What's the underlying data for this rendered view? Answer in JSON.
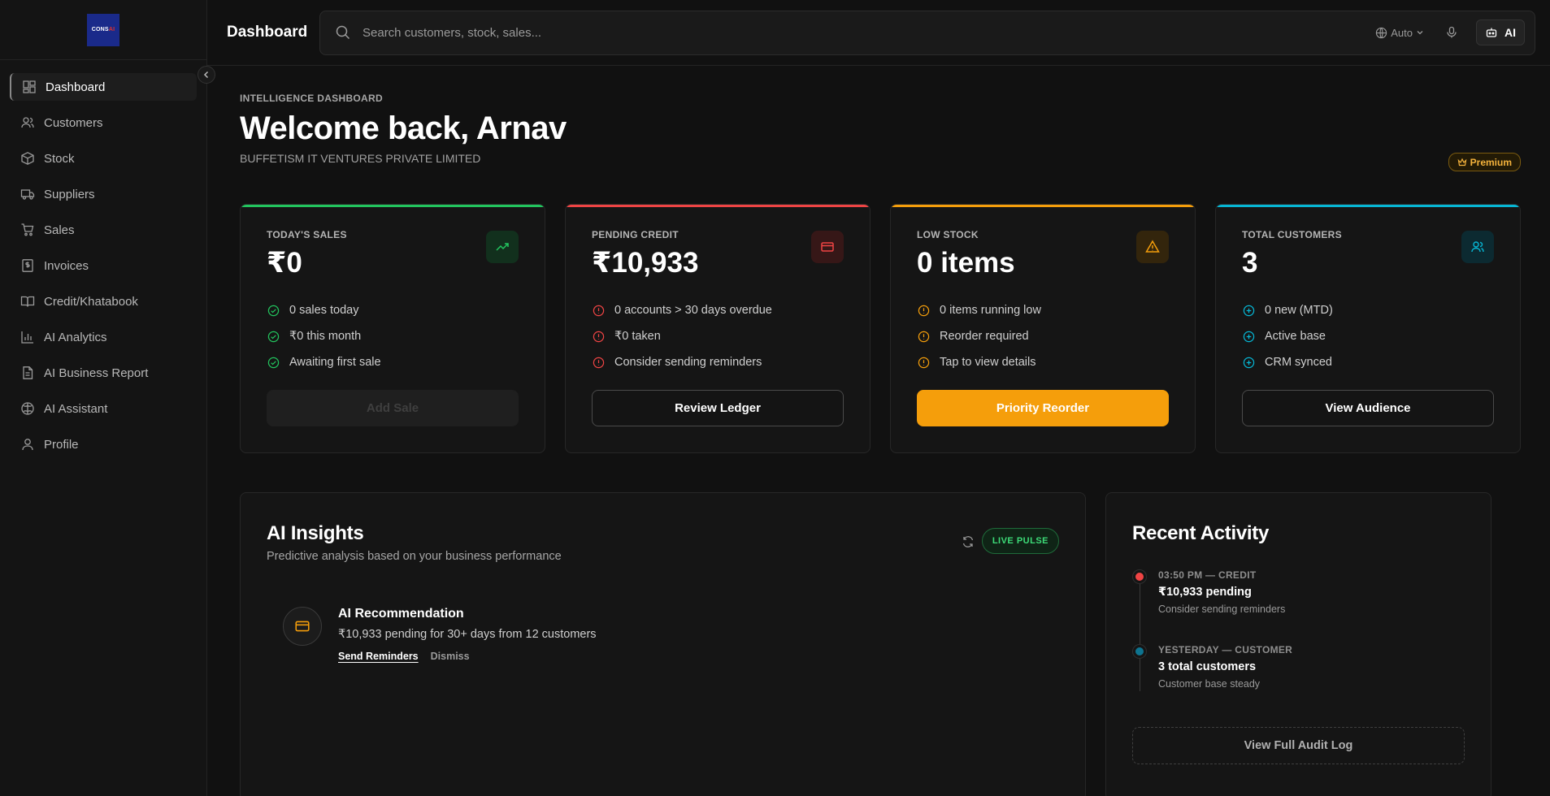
{
  "app": {
    "logo_text": "CONSAI",
    "logo_parts": [
      "CONS",
      "AI"
    ]
  },
  "sidebar": {
    "items": [
      {
        "label": "Dashboard",
        "icon": "dashboard-icon",
        "active": true
      },
      {
        "label": "Customers",
        "icon": "users-icon"
      },
      {
        "label": "Stock",
        "icon": "box-icon"
      },
      {
        "label": "Suppliers",
        "icon": "truck-icon"
      },
      {
        "label": "Sales",
        "icon": "cart-icon"
      },
      {
        "label": "Invoices",
        "icon": "invoice-icon"
      },
      {
        "label": "Credit/Khatabook",
        "icon": "book-icon"
      },
      {
        "label": "AI Analytics",
        "icon": "bar-chart-icon"
      },
      {
        "label": "AI Business Report",
        "icon": "report-icon"
      },
      {
        "label": "AI Assistant",
        "icon": "brain-icon"
      },
      {
        "label": "Profile",
        "icon": "user-icon"
      }
    ]
  },
  "header": {
    "title": "Dashboard",
    "search_placeholder": "Search customers, stock, sales...",
    "language": "Auto",
    "ai_button": "AI"
  },
  "page": {
    "eyebrow": "INTELLIGENCE DASHBOARD",
    "welcome": "Welcome back, Arnav",
    "company": "BUFFETISM IT VENTURES PRIVATE LIMITED",
    "badge": "Premium"
  },
  "cards": [
    {
      "label": "TODAY'S SALES",
      "value": "₹0",
      "accent": "#22c55e",
      "icon": "trending-up-icon",
      "bullets": [
        "0 sales today",
        "₹0 this month",
        "Awaiting first sale"
      ],
      "button": "Add Sale",
      "button_style": "disabled"
    },
    {
      "label": "PENDING CREDIT",
      "value": "₹10,933",
      "accent": "#ef4444",
      "icon": "credit-card-icon",
      "bullets": [
        "0 accounts > 30 days overdue",
        "₹0 taken",
        "Consider sending reminders"
      ],
      "button": "Review Ledger",
      "button_style": "outline"
    },
    {
      "label": "LOW STOCK",
      "value": "0 items",
      "accent": "#f59e0b",
      "icon": "warning-icon",
      "bullets": [
        "0 items running low",
        "Reorder required",
        "Tap to view details"
      ],
      "button": "Priority Reorder",
      "button_style": "amber"
    },
    {
      "label": "TOTAL CUSTOMERS",
      "value": "3",
      "accent": "#06b6d4",
      "icon": "users-icon",
      "bullets": [
        "0 new (MTD)",
        "Active base",
        "CRM synced"
      ],
      "button": "View Audience",
      "button_style": "outline"
    }
  ],
  "insights": {
    "title": "AI Insights",
    "subtitle": "Predictive analysis based on your business performance",
    "live_badge": "LIVE PULSE",
    "recommendation": {
      "title": "AI Recommendation",
      "text": "₹10,933 pending for 30+ days from 12 customers",
      "primary_action": "Send Reminders",
      "secondary_action": "Dismiss"
    }
  },
  "activity": {
    "title": "Recent Activity",
    "items": [
      {
        "meta": "03:50 PM — CREDIT",
        "title": "₹10,933 pending",
        "sub": "Consider sending reminders",
        "color": "#ef4444"
      },
      {
        "meta": "YESTERDAY — CUSTOMER",
        "title": "3 total customers",
        "sub": "Customer base steady",
        "color": "#06b6d4"
      }
    ],
    "audit_button": "View Full Audit Log"
  }
}
